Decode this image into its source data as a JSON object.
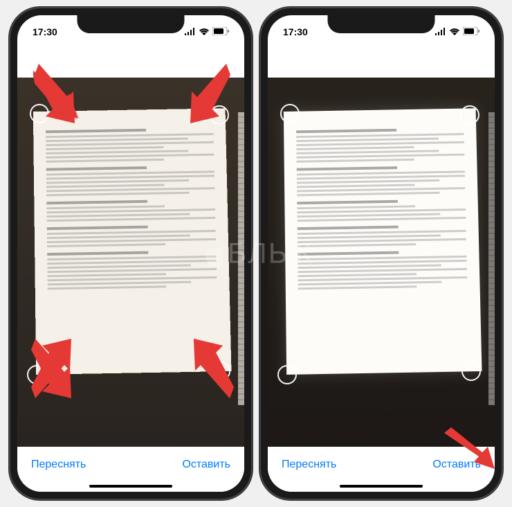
{
  "status": {
    "time": "17:30"
  },
  "buttons": {
    "retake": "Переснять",
    "keep": "Оставить"
  },
  "watermark": {
    "text": "БЛЫК"
  },
  "icons": {
    "signal": "signal-icon",
    "wifi": "wifi-icon",
    "battery": "battery-icon"
  },
  "colors": {
    "accent": "#007AFF",
    "arrow": "#E53935"
  }
}
